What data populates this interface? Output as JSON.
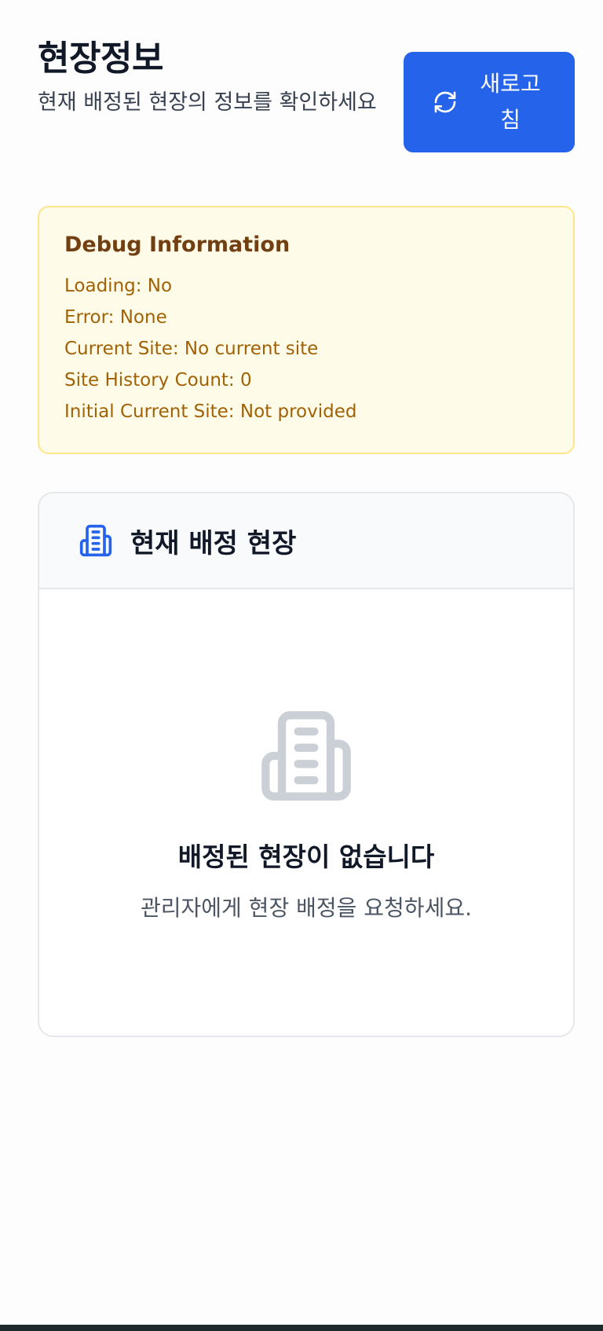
{
  "header": {
    "title": "현장정보",
    "subtitle": "현재 배정된 현장의 정보를 확인하세요",
    "refresh_label": "새로고침",
    "refresh_icon": "refresh-icon"
  },
  "debug": {
    "title": "Debug Information",
    "lines": [
      "Loading: No",
      "Error: None",
      "Current Site: No current site",
      "Site History Count: 0",
      "Initial Current Site: Not provided"
    ]
  },
  "site_card": {
    "icon": "building-icon",
    "title": "현재 배정 현장",
    "empty": {
      "icon": "building-icon",
      "title": "배정된 현장이 없습니다",
      "description": "관리자에게 현장 배정을 요청하세요."
    }
  },
  "colors": {
    "primary": "#2563eb",
    "debug_bg": "#fefce8",
    "debug_border": "#fde68a",
    "debug_title": "#713f12",
    "debug_text": "#a16207",
    "muted_icon": "#cbd0d6"
  }
}
